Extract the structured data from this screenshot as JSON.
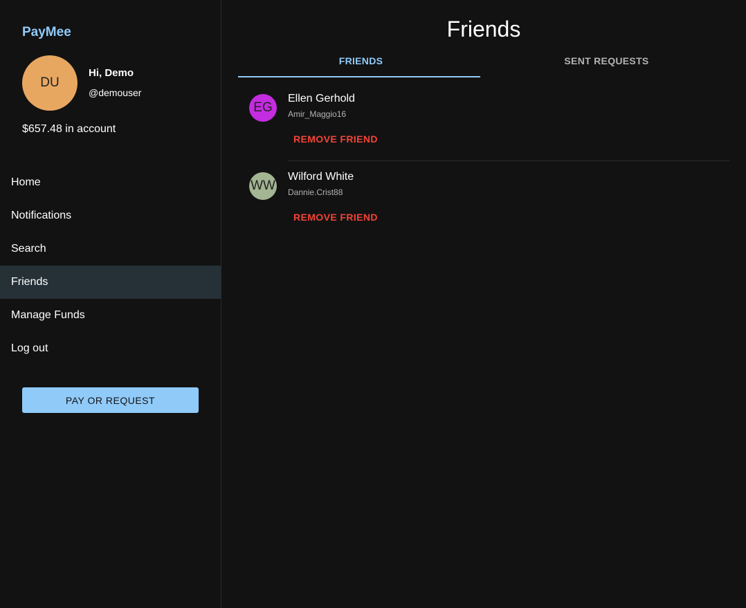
{
  "app": {
    "brand": "PayMee"
  },
  "user": {
    "initials": "DU",
    "avatar_color": "#e8a760",
    "greeting": "Hi, Demo",
    "handle": "@demouser",
    "balance": "$657.48 in account"
  },
  "nav": {
    "items": [
      {
        "label": "Home"
      },
      {
        "label": "Notifications"
      },
      {
        "label": "Search"
      },
      {
        "label": "Friends",
        "active": true
      },
      {
        "label": "Manage Funds"
      },
      {
        "label": "Log out"
      }
    ]
  },
  "pay_button": {
    "label": "PAY OR REQUEST"
  },
  "main": {
    "title": "Friends",
    "tabs": [
      {
        "label": "FRIENDS",
        "active": true
      },
      {
        "label": "SENT REQUESTS",
        "active": false
      }
    ],
    "friends": [
      {
        "initials": "EG",
        "avatar_color": "#c42ce0",
        "name": "Ellen Gerhold",
        "username": "Amir_Maggio16",
        "action": "REMOVE FRIEND"
      },
      {
        "initials": "WW",
        "avatar_color": "#a3b592",
        "name": "Wilford White",
        "username": "Dannie.Crist88",
        "action": "REMOVE FRIEND"
      }
    ]
  },
  "colors": {
    "accent": "#90caf9",
    "danger": "#f44336",
    "background": "#121212",
    "active_nav": "#253137"
  }
}
